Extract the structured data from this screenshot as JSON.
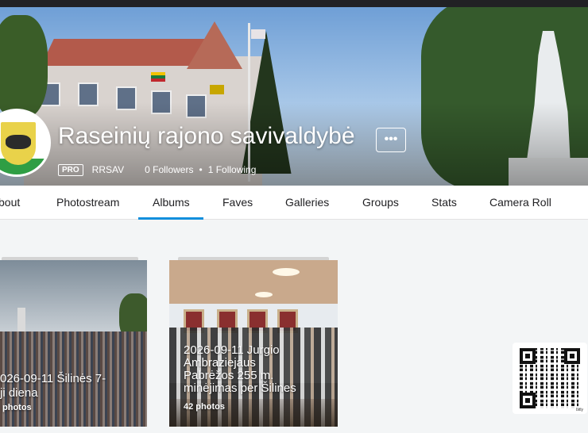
{
  "profile": {
    "name": "Raseinių rajono savivaldybė",
    "pro_badge": "PRO",
    "username": "RRSAV",
    "followers": "0 Followers",
    "separator": "•",
    "following": "1 Following",
    "more_label": "•••"
  },
  "nav": {
    "tabs": [
      {
        "label": "bout",
        "id": "about"
      },
      {
        "label": "Photostream",
        "id": "photostream"
      },
      {
        "label": "Albums",
        "id": "albums",
        "active": true
      },
      {
        "label": "Faves",
        "id": "faves"
      },
      {
        "label": "Galleries",
        "id": "galleries"
      },
      {
        "label": "Groups",
        "id": "groups"
      },
      {
        "label": "Stats",
        "id": "stats"
      },
      {
        "label": "Camera Roll",
        "id": "camera-roll"
      }
    ]
  },
  "albums": [
    {
      "title_line1": "026-09-11 Šilinės 7-",
      "title_line2": "ji diena",
      "count": " photos"
    },
    {
      "title_line1": "2026-09-11 Jurgio",
      "title_line2": "Ambraziejaus",
      "title_line3": "Pabrėžos 255 m.",
      "title_line4": "minėjimas per Šilines",
      "count": "42 photos"
    }
  ],
  "qr": {
    "brand": "bitly"
  },
  "colors": {
    "accent": "#128fdc",
    "topbar": "#212124",
    "page_background": "#f3f5f6"
  }
}
